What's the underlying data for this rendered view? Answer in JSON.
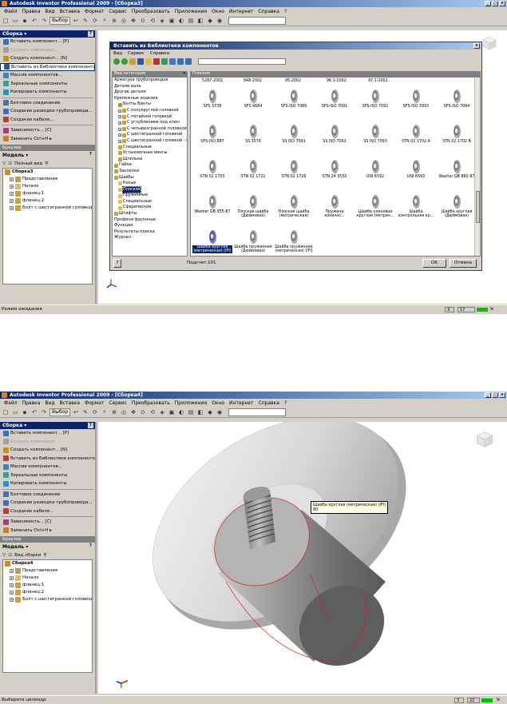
{
  "top": {
    "title": "Autodesk Inventor Professional 2009 - [Сборка3]",
    "menu": [
      "Файл",
      "Правка",
      "Вид",
      "Вставка",
      "Формат",
      "Сервис",
      "Преобразовать",
      "Приложения",
      "Окно",
      "Интернет",
      "Справка",
      "?"
    ],
    "toolbar": {
      "select_label": "Выбор"
    },
    "assembly_panel": {
      "header": "Сборка ▾",
      "items": [
        {
          "label": "Вставить компонент...  [P]",
          "state": "normal",
          "icon_color": "#3a70c0"
        },
        {
          "label": "Создать компонент...",
          "state": "disabled",
          "icon_color": "#a0a0a0"
        },
        {
          "label": "Создать компонент...  [N]",
          "state": "normal",
          "icon_color": "#c09030"
        },
        {
          "label": "Вставить из Библиотеки компонентов...",
          "state": "selected",
          "icon_color": "#3050a0"
        },
        {
          "label": "Массив компонентов...",
          "state": "normal",
          "icon_color": "#4080c0"
        },
        {
          "label": "Зеркальные компоненты",
          "state": "normal",
          "icon_color": "#30a0a0"
        },
        {
          "label": "Копировать компоненты",
          "state": "normal",
          "icon_color": "#3090c0"
        },
        {
          "label": "Болтовое соединение",
          "state": "normal",
          "icon_color": "#5070a0"
        },
        {
          "label": "Создание разводки трубопровода...",
          "state": "normal",
          "icon_color": "#4070b0"
        },
        {
          "label": "Создание кабеля...",
          "state": "normal",
          "icon_color": "#b04040"
        },
        {
          "label": "Зависимость...  [C]",
          "state": "normal",
          "icon_color": "#a04080"
        },
        {
          "label": "Заменить  Ctrl+H  ▸",
          "state": "normal",
          "icon_color": "#c08030"
        }
      ]
    },
    "browser": {
      "label": "Браузер",
      "model_header": "Модель ▾",
      "view_label": "Полный вид",
      "tree": [
        {
          "label": "Сборка3",
          "bold": true,
          "level": 0,
          "toggle": "",
          "icon_color": "#c09030"
        },
        {
          "label": "Представления",
          "bold": false,
          "level": 1,
          "toggle": "+",
          "icon_color": "#c0a040"
        },
        {
          "label": "Начало",
          "bold": false,
          "level": 1,
          "toggle": "+",
          "icon_color": "#d8c070"
        },
        {
          "label": "фланец:1",
          "bold": false,
          "level": 1,
          "toggle": "+",
          "icon_color": "#d0a030"
        },
        {
          "label": "фланец:2",
          "bold": false,
          "level": 1,
          "toggle": "+",
          "icon_color": "#d0a030"
        },
        {
          "label": "Болт с шестигранной головкой - метр",
          "bold": false,
          "level": 1,
          "toggle": "+",
          "icon_color": "#d0a030"
        }
      ]
    },
    "dialog": {
      "title": "Вставить из Библиотеки компонентов",
      "menu": [
        "Вид",
        "Сервис",
        "Справка"
      ],
      "category_header": "Вид категории",
      "close_glyph": "✕",
      "categories": [
        {
          "label": "Арматура трубопроводов",
          "level": 0,
          "toggle": "",
          "icon": "",
          "selected": false
        },
        {
          "label": "Детали вала",
          "level": 0,
          "toggle": "",
          "icon": "",
          "selected": false
        },
        {
          "label": "Другие детали",
          "level": 0,
          "toggle": "",
          "icon": "",
          "selected": false
        },
        {
          "label": "Крепежные изделия",
          "level": 0,
          "toggle": "",
          "icon": "",
          "selected": false
        },
        {
          "label": "Болты Винты",
          "level": 1,
          "toggle": "",
          "icon": "#c09030",
          "selected": false
        },
        {
          "label": "С полукруглой головкой",
          "level": 1,
          "toggle": "+",
          "icon": "#d0a030",
          "selected": false
        },
        {
          "label": "С потайной головкой",
          "level": 1,
          "toggle": "+",
          "icon": "#d0a030",
          "selected": false
        },
        {
          "label": "С углублением под ключ",
          "level": 1,
          "toggle": "+",
          "icon": "#d0a030",
          "selected": false
        },
        {
          "label": "С четырехгранной головкой",
          "level": 1,
          "toggle": "+",
          "icon": "#d0a030",
          "selected": false
        },
        {
          "label": "С шестигранной головкой",
          "level": 1,
          "toggle": "+",
          "icon": "#d0a030",
          "selected": false
        },
        {
          "label": "С шестигранной головкой - фл",
          "level": 1,
          "toggle": "+",
          "icon": "#d0a030",
          "selected": false
        },
        {
          "label": "Специальные",
          "level": 1,
          "toggle": "",
          "icon": "#d0a030",
          "selected": false
        },
        {
          "label": "Установочные винты",
          "level": 1,
          "toggle": "",
          "icon": "#d0a030",
          "selected": false
        },
        {
          "label": "Шпильки",
          "level": 1,
          "toggle": "",
          "icon": "#d0a030",
          "selected": false
        },
        {
          "label": "Гайки",
          "level": 0,
          "toggle": "",
          "icon": "#d0a030",
          "selected": false
        },
        {
          "label": "Заклепки",
          "level": 0,
          "toggle": "",
          "icon": "#d0a030",
          "selected": false
        },
        {
          "label": "Шайбы",
          "level": 0,
          "toggle": "",
          "icon": "#d0a030",
          "selected": false
        },
        {
          "label": "Косые",
          "level": 1,
          "toggle": "",
          "icon": "#e0c060",
          "selected": false
        },
        {
          "label": "Плоские",
          "level": 1,
          "toggle": "",
          "icon": "#e0c060",
          "selected": true
        },
        {
          "label": "Пружинные",
          "level": 1,
          "toggle": "",
          "icon": "#e0c060",
          "selected": false
        },
        {
          "label": "Специальные",
          "level": 1,
          "toggle": "",
          "icon": "#e0c060",
          "selected": false
        },
        {
          "label": "Сферические",
          "level": 1,
          "toggle": "",
          "icon": "#e0c060",
          "selected": false
        },
        {
          "label": "Штифты",
          "level": 0,
          "toggle": "",
          "icon": "#d0a030",
          "selected": false
        },
        {
          "label": "Профили фасонные",
          "level": 0,
          "toggle": "",
          "icon": "",
          "selected": false
        },
        {
          "label": "Функции",
          "level": 0,
          "toggle": "",
          "icon": "",
          "selected": false
        },
        {
          "label": "Результаты поиска",
          "level": 0,
          "toggle": "",
          "icon": "",
          "selected": false
        },
        {
          "label": "Журнал",
          "level": 0,
          "toggle": "",
          "icon": "",
          "selected": false
        }
      ],
      "grid_header": "Плоские",
      "top_row": [
        "5287-2002",
        "848-2002",
        "95-2002",
        "96.1-2002",
        "97.1-2002"
      ],
      "items": [
        {
          "label": "SFS 3738",
          "highlight": false
        },
        {
          "label": "SFS 4684",
          "highlight": false
        },
        {
          "label": "SFS-ISO 7089",
          "highlight": false
        },
        {
          "label": "SFS-ISO 7091",
          "highlight": false
        },
        {
          "label": "SFS-ISO 7092",
          "highlight": false
        },
        {
          "label": "SFS-ISO 7093",
          "highlight": false
        },
        {
          "label": "SFS-ISO 7094",
          "highlight": false
        },
        {
          "label": "SFS-ISO 887",
          "highlight": false
        },
        {
          "label": "SS 3576",
          "highlight": false
        },
        {
          "label": "SS ISO 7091",
          "highlight": false
        },
        {
          "label": "SS ISO 7092",
          "highlight": false
        },
        {
          "label": "SS ISO 7093",
          "highlight": false
        },
        {
          "label": "STN 02 1702 A",
          "highlight": false
        },
        {
          "label": "STN 02 1702 B",
          "highlight": false
        },
        {
          "label": "STN 02 1703",
          "highlight": false
        },
        {
          "label": "STN 02 1721",
          "highlight": false
        },
        {
          "label": "STN 02 1726",
          "highlight": false
        },
        {
          "label": "STN 24 3550",
          "highlight": false
        },
        {
          "label": "UNI 6592",
          "highlight": false
        },
        {
          "label": "UNI 6593",
          "highlight": false
        },
        {
          "label": "Washer GB 860-87",
          "highlight": false
        },
        {
          "label": "Washer GB 955-87",
          "highlight": false
        },
        {
          "label": "Плоская шайба (Дюймовая)",
          "highlight": false
        },
        {
          "label": "Плоская шайба (метрическая)",
          "highlight": false
        },
        {
          "label": "Пружина коничес...",
          "highlight": false
        },
        {
          "label": "Шайба клиновая круглая (метрич...",
          "highlight": false
        },
        {
          "label": "Шайба контрольная кр...",
          "highlight": false
        },
        {
          "label": "Шайба круглая (Дюймовая)",
          "highlight": false
        },
        {
          "label": "Шайба круглая (метрическая) (IFI)",
          "highlight": true
        },
        {
          "label": "Шайба пружинная (Дюймовая)",
          "highlight": false
        },
        {
          "label": "Шайба пружинная (метрическая) (IFI)",
          "highlight": false
        }
      ],
      "count_label": "Подсчет:101",
      "help_glyph": "?",
      "ok": "OK",
      "cancel": "Отмена"
    },
    "status": {
      "text": "Режим ожидания",
      "n1": "3",
      "n2": "17"
    }
  },
  "bottom": {
    "title": "Autodesk Inventor Professional 2009 - [Сборка4]",
    "menu": [
      "Файл",
      "Правка",
      "Вид",
      "Вставка",
      "Формат",
      "Сервис",
      "Преобразовать",
      "Приложения",
      "Окно",
      "Интернет",
      "Справка",
      "?"
    ],
    "toolbar": {
      "select_label": "Выбор"
    },
    "assembly_panel": {
      "header": "Сборка ▾",
      "items": [
        {
          "label": "Вставить компонент...  [P]",
          "state": "normal",
          "icon_color": "#3a70c0"
        },
        {
          "label": "Создать компонент...",
          "state": "disabled",
          "icon_color": "#a0a0a0"
        },
        {
          "label": "Создать компонент...  [N]",
          "state": "normal",
          "icon_color": "#c09030"
        },
        {
          "label": "Вставить из Библиотеки компонентов...",
          "state": "normal",
          "icon_color": "#b04040"
        },
        {
          "label": "Массив компонентов...",
          "state": "normal",
          "icon_color": "#4080c0"
        },
        {
          "label": "Зеркальные компоненты",
          "state": "normal",
          "icon_color": "#30a0a0"
        },
        {
          "label": "Копировать компоненты",
          "state": "normal",
          "icon_color": "#3090c0"
        },
        {
          "label": "Болтовое соединение",
          "state": "normal",
          "icon_color": "#5070a0"
        },
        {
          "label": "Создание разводки трубопровода...",
          "state": "normal",
          "icon_color": "#4070b0"
        },
        {
          "label": "Создание кабеля...",
          "state": "normal",
          "icon_color": "#b04040"
        },
        {
          "label": "Зависимость...  [C]",
          "state": "normal",
          "icon_color": "#a04080"
        },
        {
          "label": "Заменить  Ctrl+H  ▸",
          "state": "normal",
          "icon_color": "#c08030"
        }
      ]
    },
    "browser": {
      "label": "Браузер",
      "model_header": "Модель ▾",
      "view_label": "Вид сборки",
      "tree": [
        {
          "label": "Сборка4",
          "bold": true,
          "level": 0,
          "toggle": "",
          "icon_color": "#c09030"
        },
        {
          "label": "Представления",
          "bold": false,
          "level": 1,
          "toggle": "+",
          "icon_color": "#c0a040"
        },
        {
          "label": "Начало",
          "bold": false,
          "level": 1,
          "toggle": "+",
          "icon_color": "#d8c070"
        },
        {
          "label": "фланец:1",
          "bold": false,
          "level": 1,
          "toggle": "+",
          "icon_color": "#d0a030"
        },
        {
          "label": "фланец:2",
          "bold": false,
          "level": 1,
          "toggle": "+",
          "icon_color": "#d0a030"
        },
        {
          "label": "Болт с шестигранной головкой - метр",
          "bold": false,
          "level": 1,
          "toggle": "+",
          "icon_color": "#d0a030"
        }
      ]
    },
    "tooltip": "Шайба круглая (метрическая) (IFI)",
    "tooltip_sub": "80",
    "status": {
      "text": "Выберите цилиндр",
      "n1": "3",
      "n2": "22"
    }
  },
  "colors": {
    "titlebar": "#0a246a",
    "chrome": "#d4d0c8",
    "selection": "#0a246a",
    "status_green": "#00c000"
  }
}
